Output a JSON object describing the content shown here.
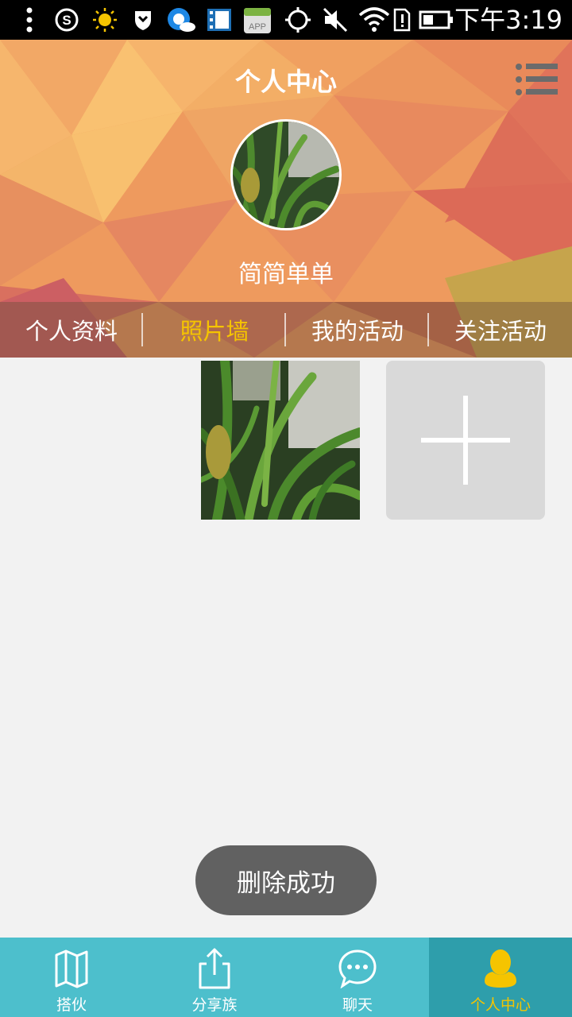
{
  "status_bar": {
    "time": "下午3:19",
    "icons": [
      "more-vert-icon",
      "sogou-icon",
      "sun-icon",
      "shield-icon",
      "cloud-icon",
      "film-icon",
      "app-store-icon",
      "gps-icon",
      "mute-icon",
      "wifi-icon",
      "sim-alert-icon",
      "battery-icon"
    ],
    "app_badge": "APP"
  },
  "header": {
    "title": "个人中心",
    "username": "简简单单"
  },
  "tabs": [
    {
      "label": "个人资料",
      "active": false
    },
    {
      "label": "照片墙",
      "active": true
    },
    {
      "label": "我的活动",
      "active": false
    },
    {
      "label": "关注活动",
      "active": false
    }
  ],
  "toast": "删除成功",
  "bottom_nav": [
    {
      "label": "搭伙",
      "icon": "map-icon",
      "active": false
    },
    {
      "label": "分享族",
      "icon": "share-icon",
      "active": false
    },
    {
      "label": "聊天",
      "icon": "chat-icon",
      "active": false
    },
    {
      "label": "个人中心",
      "icon": "person-icon",
      "active": true
    }
  ],
  "colors": {
    "accent": "#f5c400",
    "nav_bg": "#4dbfcc",
    "nav_active_bg": "#2e9eab",
    "status_bar": "#000000"
  }
}
